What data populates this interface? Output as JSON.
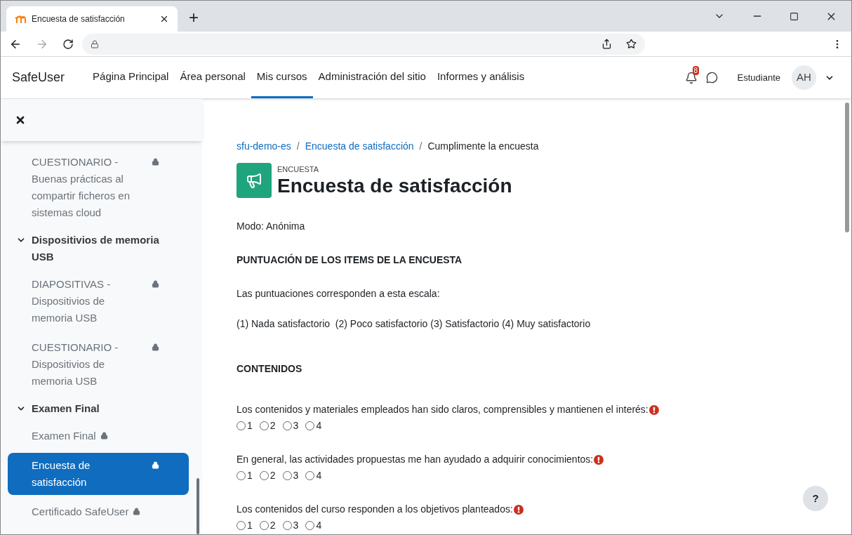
{
  "browser": {
    "tab_title": "Encuesta de satisfacción",
    "new_tab": "+"
  },
  "navbar": {
    "brand": "SafeUser",
    "links": [
      {
        "label": "Página Principal",
        "selected": false
      },
      {
        "label": "Área personal",
        "selected": false
      },
      {
        "label": "Mis cursos",
        "selected": true
      },
      {
        "label": "Administración del sitio",
        "selected": false
      },
      {
        "label": "Informes y análisis",
        "selected": false
      }
    ],
    "notification_count": "8",
    "role": "Estudiante",
    "avatar": "AH"
  },
  "sidebar": {
    "items": [
      {
        "kind": "activity",
        "label": "CUESTIONARIO - Buenas prácticas al compartir ficheros en sistemas cloud",
        "locked": true,
        "selected": false
      },
      {
        "kind": "section",
        "label": "Dispositivios de memoria USB",
        "expanded": true
      },
      {
        "kind": "activity",
        "label": "DIAPOSITIVAS - Dispositivios de memoria USB",
        "locked": true,
        "selected": false
      },
      {
        "kind": "activity",
        "label": "CUESTIONARIO - Dispositivios de memoria USB",
        "locked": true,
        "selected": false
      },
      {
        "kind": "section",
        "label": "Examen Final",
        "expanded": true
      },
      {
        "kind": "activity",
        "label": "Examen Final",
        "locked": true,
        "selected": false
      },
      {
        "kind": "activity",
        "label": "Encuesta de satisfacción",
        "locked": true,
        "selected": true
      },
      {
        "kind": "activity",
        "label": "Certificado SafeUser",
        "locked": true,
        "selected": false
      }
    ]
  },
  "breadcrumb": [
    {
      "label": "sfu-demo-es",
      "link": true
    },
    {
      "label": "/",
      "link": false,
      "kind": "separator"
    },
    {
      "label": "Encuesta de satisfacción",
      "link": true
    },
    {
      "label": "/",
      "link": false,
      "kind": "separator"
    },
    {
      "label": "Cumplimente la encuesta",
      "link": false
    }
  ],
  "activity": {
    "type": "ENCUESTA",
    "title": "Encuesta de satisfacción"
  },
  "mode": "Modo: Anónima",
  "scale_heading": "PUNTUACIÓN DE LOS ITEMS DE LA ENCUESTA",
  "scale_intro": "Las puntuaciones corresponden a esta escala:",
  "scale": "(1) Nada satisfactorio  (2) Poco satisfactorio (3) Satisfactorio (4) Muy satisfactorio",
  "section_heading": "CONTENIDOS",
  "questions": [
    {
      "text": "Los contenidos y materiales empleados han sido claros, comprensibles y mantienen el interés:",
      "required": true,
      "options": [
        {
          "label": "1",
          "selected": false
        },
        {
          "label": "2",
          "selected": false
        },
        {
          "label": "3",
          "selected": false
        },
        {
          "label": "4",
          "selected": false
        }
      ]
    },
    {
      "text": "En general, las actividades propuestas me han ayudado a adquirir conocimientos:",
      "required": true,
      "options": [
        {
          "label": "1",
          "selected": false
        },
        {
          "label": "2",
          "selected": false
        },
        {
          "label": "3",
          "selected": false
        },
        {
          "label": "4",
          "selected": false
        }
      ]
    },
    {
      "text": "Los contenidos del curso responden a los objetivos planteados:",
      "required": true,
      "options": [
        {
          "label": "1",
          "selected": false
        },
        {
          "label": "2",
          "selected": false
        },
        {
          "label": "3",
          "selected": false
        },
        {
          "label": "4",
          "selected": false
        }
      ]
    }
  ],
  "help_button": "?"
}
